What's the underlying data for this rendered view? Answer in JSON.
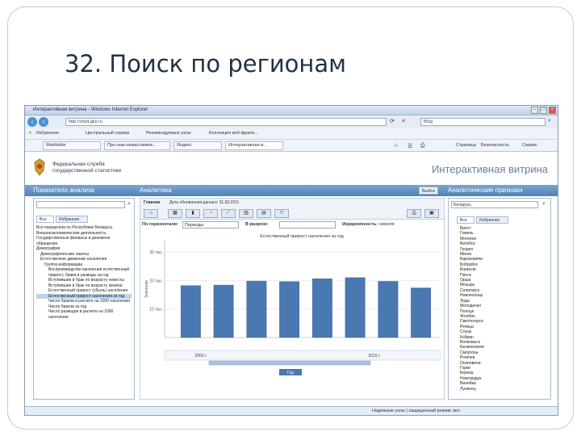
{
  "slide": {
    "title": "32. Поиск по регионам"
  },
  "browser": {
    "title": "Интерактивная витрина - Windows Internet Explorer",
    "url": "http://cbsd.gks.ru",
    "search_engine": "Bing",
    "favorites_label": "Избранное",
    "favorites": [
      "Центральный сервер",
      "Рекомендуемые узлы",
      "Коллекция веб-фрагм..."
    ],
    "tabs": [
      "Webfolder",
      "Про-нам-немыслимое...",
      "Яндекс",
      "Интерактивная в..."
    ],
    "menu": [
      "Страница",
      "Безопасность",
      "Сервис"
    ],
    "status_right": "Надежные узлы | защищенный режим: вкл"
  },
  "header": {
    "org_line1": "Федеральная служба",
    "org_line2": "государственной статистики",
    "app_title": "Интерактивная витрина"
  },
  "panelbar": {
    "left": "Показатели анализа",
    "center": "Аналитика",
    "exit": "Выйти",
    "right": "Аналитические признаки"
  },
  "left_panel": {
    "tabs": [
      "Все",
      "Избранное"
    ],
    "tree": [
      "Все показатели по Республике Беларусь",
      "Внешнеэкономическая деятельность",
      "Государственные финансы и денежное обращение",
      "Демография",
      "Демографические пакеты",
      "Естественное движение населения",
      "Группа информации",
      "Воспроизводство населения естественный прирост, браки и разводы за год",
      "Вступившие в брак по возрасту невесты",
      "Вступившие в брак по возрасту жениха",
      "Естественный прирост (убыль) населения",
      "Естественный прирост населения за год",
      "Число браков в расчете на 1000 населения",
      "Число браков за год",
      "Число разводов в расчете на 1000 населения"
    ],
    "selected_index": 11
  },
  "center": {
    "toolbar_labels": {
      "tab": "Главная",
      "last_update": "Дата обновления данных: 31.03.2011",
      "view": "Вид представления данных",
      "filters": "Доступные фильтры",
      "export": "Сохранить"
    },
    "filters": {
      "horizontal_label": "По горизонтали:",
      "horizontal_value": "Периоды",
      "section_label": "В разрезе:",
      "section_value": "",
      "detail_label": "Иерархичность:",
      "detail_value": "нижняя"
    }
  },
  "chart_data": {
    "type": "bar",
    "title": "Естественный прирост населения за год",
    "ylabel": "Значение",
    "yticks": [
      "30 тыс.",
      "20 тыс.",
      "10 тыс."
    ],
    "ylim": [
      0,
      34
    ],
    "values": [
      18.2,
      18.4,
      19.8,
      19.6,
      20.6,
      21.0,
      19.7,
      17.4
    ],
    "xlabels": [
      "2003 г.",
      "2010 г."
    ],
    "scroll_button": "Год"
  },
  "right_panel": {
    "tabs": [
      "Все",
      "Избранное"
    ],
    "search_value": "Беларусь",
    "items": [
      "Брест",
      "Гомель",
      "Могилев",
      "Витебск",
      "Гродно",
      "Минск",
      "Барановичи",
      "Бобруйск",
      "Борисов",
      "Пинск",
      "Орша",
      "Мозырь",
      "Солигорск",
      "Новополоцк",
      "Лида",
      "Молодечно",
      "Полоцк",
      "Жлобин",
      "Светлогорск",
      "Речица",
      "Слуцк",
      "Кобрин",
      "Волковыск",
      "Калинковичи",
      "Сморгонь",
      "Рогачев",
      "Осиповичи",
      "Горки",
      "Береза",
      "Новогрудок",
      "Вилейка",
      "Лунинец"
    ]
  }
}
